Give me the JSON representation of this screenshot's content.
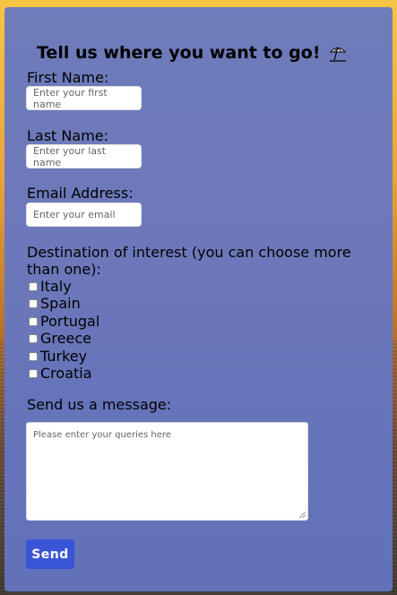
{
  "form": {
    "title": "Tell us where you want to go!",
    "title_icon": "beach-umbrella-icon",
    "first_name_label": "First Name:",
    "first_name_placeholder": "Enter your first name",
    "last_name_label": "Last Name:",
    "last_name_placeholder": "Enter your last name",
    "email_label": "Email Address:",
    "email_placeholder": "Enter your email",
    "destination_label": "Destination of interest (you can choose more than one):",
    "destinations": [
      {
        "label": "Italy",
        "checked": false
      },
      {
        "label": "Spain",
        "checked": false
      },
      {
        "label": "Portugal",
        "checked": false
      },
      {
        "label": "Greece",
        "checked": false
      },
      {
        "label": "Turkey",
        "checked": false
      },
      {
        "label": "Croatia",
        "checked": false
      }
    ],
    "message_label": "Send us a message:",
    "message_placeholder": "Please enter your queries here",
    "send_label": "Send"
  },
  "colors": {
    "card": "#6476c4",
    "button": "#3a56d6",
    "sunset": "#f6c544"
  }
}
